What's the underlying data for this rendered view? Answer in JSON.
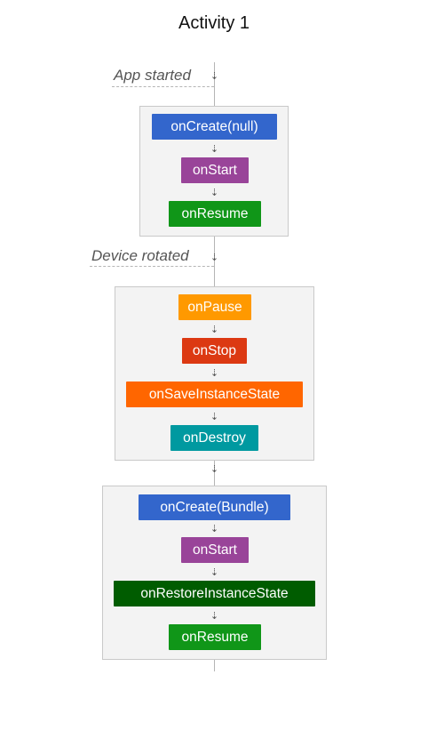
{
  "title": "Activity 1",
  "events": {
    "app_started": "App started",
    "device_rotated": "Device rotated"
  },
  "groups": {
    "first": {
      "callbacks": [
        {
          "label": "onCreate(null)",
          "color": "#3366cc"
        },
        {
          "label": "onStart",
          "color": "#994499"
        },
        {
          "label": "onResume",
          "color": "#109618"
        }
      ]
    },
    "second": {
      "callbacks": [
        {
          "label": "onPause",
          "color": "#ff9900"
        },
        {
          "label": "onStop",
          "color": "#dc3912"
        },
        {
          "label": "onSaveInstanceState",
          "color": "#ff6600"
        },
        {
          "label": "onDestroy",
          "color": "#0099a0"
        }
      ]
    },
    "third": {
      "callbacks": [
        {
          "label": "onCreate(Bundle)",
          "color": "#3366cc"
        },
        {
          "label": "onStart",
          "color": "#994499"
        },
        {
          "label": "onRestoreInstanceState",
          "color": "#005c00"
        },
        {
          "label": "onResume",
          "color": "#109618"
        }
      ]
    }
  },
  "arrow_glyph": "⇣",
  "colors": {
    "box_background": "#f3f3f3",
    "box_border": "#c9c9c9",
    "line": "#b5b5b5"
  }
}
